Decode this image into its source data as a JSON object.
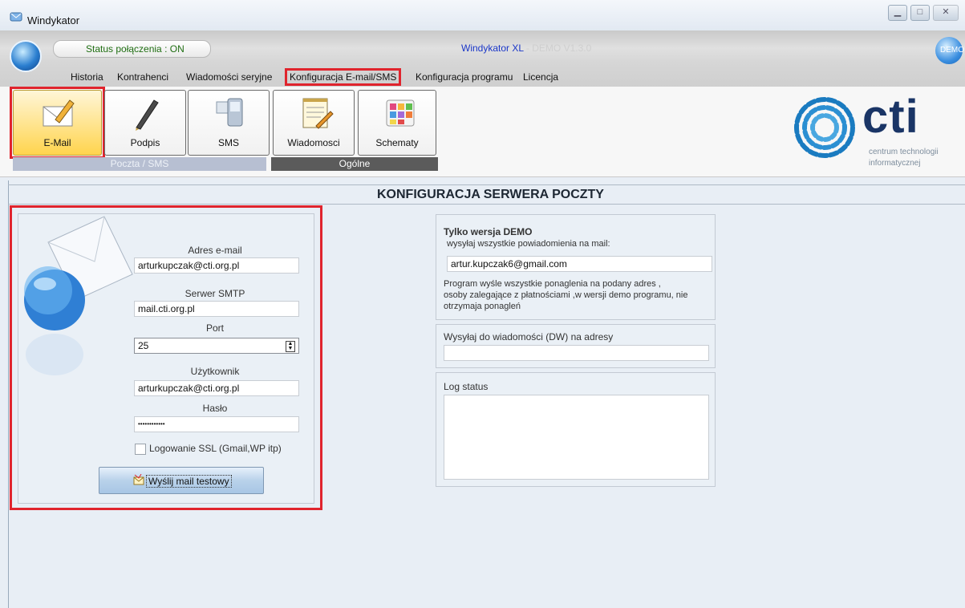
{
  "window": {
    "title": "Windykator"
  },
  "header": {
    "status": "Status połączenia : ON",
    "app_name": "Windykator XL",
    "app_version": " - DEMO V1.3.0",
    "demo_badge": "DEMO"
  },
  "menu": {
    "items": [
      "Historia",
      "Kontrahenci",
      "Wiadomości seryjne",
      "Konfiguracja E-mail/SMS",
      "Konfiguracja programu",
      "Licencja"
    ],
    "active_index": 3
  },
  "ribbon": {
    "buttons": [
      "E-Mail",
      "Podpis",
      "SMS",
      "Wiadomosci",
      "Schematy"
    ],
    "selected": "E-Mail",
    "groups": [
      "Poczta / SMS",
      "Ogólne"
    ],
    "logo": {
      "brand": "cti",
      "tagline_1": "centrum technologii",
      "tagline_2": "informatycznej"
    }
  },
  "page": {
    "title": "KONFIGURACJA SERWERA POCZTY"
  },
  "smtp_form": {
    "email_label": "Adres e-mail",
    "email_value": "arturkupczak@cti.org.pl",
    "server_label": "Serwer SMTP",
    "server_value": "mail.cti.org.pl",
    "port_label": "Port",
    "port_value": "25",
    "user_label": "Użytkownik",
    "user_value": "arturkupczak@cti.org.pl",
    "password_label": "Hasło",
    "password_value": "••••••••••••",
    "ssl_label": "Logowanie SSL (Gmail,WP itp)",
    "ssl_checked": false,
    "test_button": "Wyślij mail testowy"
  },
  "demo_panel": {
    "title": "Tylko wersja DEMO",
    "subtitle": "wysyłaj wszystkie powiadomienia na mail:",
    "email_value": "artur.kupczak6@gmail.com",
    "note_1": "Program wyśle wszystkie ponaglenia na podany adres ,",
    "note_2": "osoby zalegające z płatnościami ,w wersji demo programu, nie",
    "note_3": "otrzymaja ponagleń"
  },
  "cc_panel": {
    "label": "Wysyłaj do wiadomości (DW) na adresy",
    "value": ""
  },
  "log_panel": {
    "label": "Log status",
    "value": ""
  },
  "colors": {
    "highlight": "#e0242d",
    "app_name": "#1a36c7",
    "status_on": "#1f6e12"
  }
}
